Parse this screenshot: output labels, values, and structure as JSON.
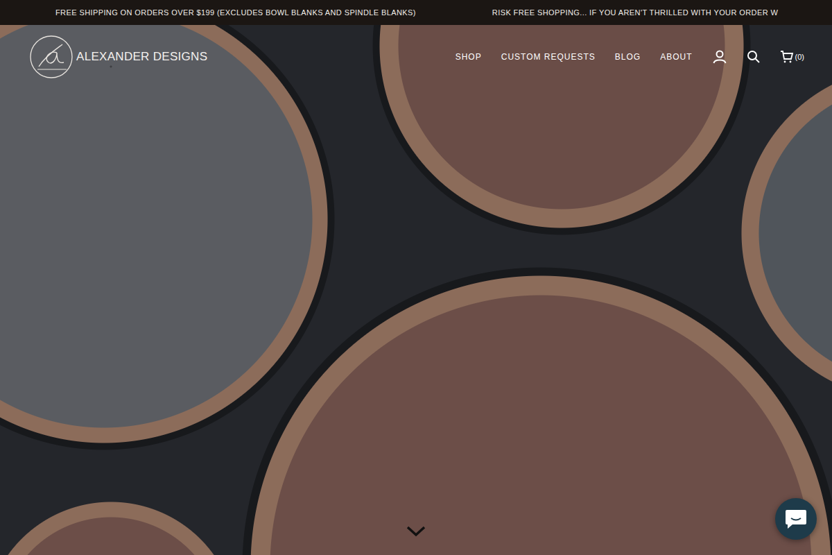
{
  "announcements": [
    "FREE SHIPPING ON ORDERS OVER $199 (EXCLUDES BOWL BLANKS AND SPINDLE BLANKS)",
    "RISK FREE SHOPPING... IF YOU AREN'T THRILLED WITH YOUR ORDER W"
  ],
  "header": {
    "brand": "ALEXANDER DESIGNS",
    "nav": [
      {
        "label": "SHOP"
      },
      {
        "label": "CUSTOM REQUESTS"
      },
      {
        "label": "BLOG"
      },
      {
        "label": "ABOUT"
      }
    ],
    "cart_count": "(0)"
  }
}
